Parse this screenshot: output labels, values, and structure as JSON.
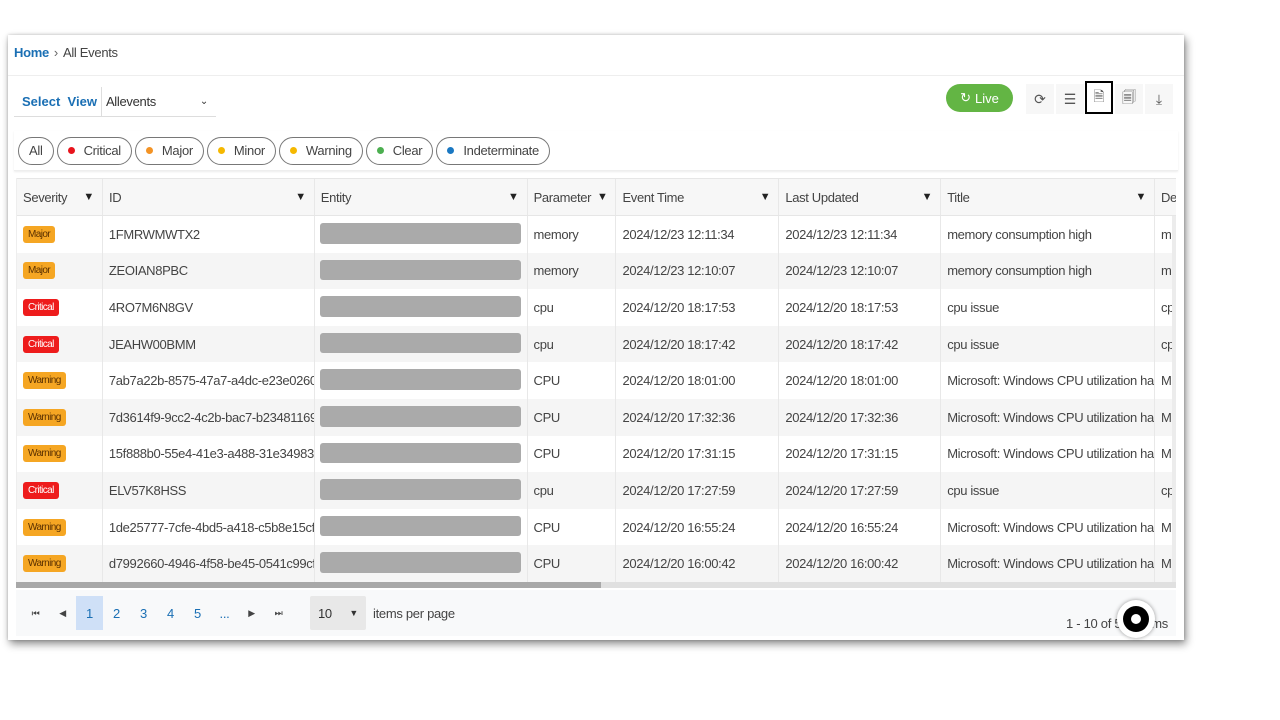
{
  "breadcrumb": {
    "home": "Home",
    "current": "All Events"
  },
  "view": {
    "label1": "Select",
    "label2": "View",
    "selected": "Allevents"
  },
  "toolbar": {
    "live_label": "Live",
    "icons": [
      "refresh-icon",
      "list-icon",
      "export-file-icon",
      "report-icon",
      "download-icon"
    ]
  },
  "filters": [
    {
      "label": "All",
      "color": null
    },
    {
      "label": "Critical",
      "color": "#e8141c"
    },
    {
      "label": "Major",
      "color": "#f39325"
    },
    {
      "label": "Minor",
      "color": "#f5b800"
    },
    {
      "label": "Warning",
      "color": "#f5b800"
    },
    {
      "label": "Clear",
      "color": "#4caf50"
    },
    {
      "label": "Indeterminate",
      "color": "#1a78c2"
    }
  ],
  "severity_colors": {
    "Major": "#f5a623",
    "Critical": "#ee1c1c",
    "Warning": "#f5a623"
  },
  "columns": [
    "Severity",
    "ID",
    "Entity",
    "Parameter",
    "Event Time",
    "Last Updated",
    "Title",
    "De"
  ],
  "rows": [
    {
      "severity": "Major",
      "id": "1FMRWMWTX2",
      "parameter": "memory",
      "event_time": "2024/12/23 12:11:34",
      "last_updated": "2024/12/23 12:11:34",
      "title": "memory consumption high",
      "desc": "m"
    },
    {
      "severity": "Major",
      "id": "ZEOIAN8PBC",
      "parameter": "memory",
      "event_time": "2024/12/23 12:10:07",
      "last_updated": "2024/12/23 12:10:07",
      "title": "memory consumption high",
      "desc": "m"
    },
    {
      "severity": "Critical",
      "id": "4RO7M6N8GV",
      "parameter": "cpu",
      "event_time": "2024/12/20 18:17:53",
      "last_updated": "2024/12/20 18:17:53",
      "title": "cpu issue",
      "desc": "cp"
    },
    {
      "severity": "Critical",
      "id": "JEAHW00BMM",
      "parameter": "cpu",
      "event_time": "2024/12/20 18:17:42",
      "last_updated": "2024/12/20 18:17:42",
      "title": "cpu issue",
      "desc": "cp"
    },
    {
      "severity": "Warning",
      "id": "7ab7a22b-8575-47a7-a4dc-e23e0260...",
      "parameter": "CPU",
      "event_time": "2024/12/20 18:01:00",
      "last_updated": "2024/12/20 18:01:00",
      "title": "Microsoft: Windows CPU utilization ha...",
      "desc": "M"
    },
    {
      "severity": "Warning",
      "id": "7d3614f9-9cc2-4c2b-bac7-b23481169...",
      "parameter": "CPU",
      "event_time": "2024/12/20 17:32:36",
      "last_updated": "2024/12/20 17:32:36",
      "title": "Microsoft: Windows CPU utilization ha...",
      "desc": "M"
    },
    {
      "severity": "Warning",
      "id": "15f888b0-55e4-41e3-a488-31e34983...",
      "parameter": "CPU",
      "event_time": "2024/12/20 17:31:15",
      "last_updated": "2024/12/20 17:31:15",
      "title": "Microsoft: Windows CPU utilization ha...",
      "desc": "M"
    },
    {
      "severity": "Critical",
      "id": "ELV57K8HSS",
      "parameter": "cpu",
      "event_time": "2024/12/20 17:27:59",
      "last_updated": "2024/12/20 17:27:59",
      "title": "cpu issue",
      "desc": "cp"
    },
    {
      "severity": "Warning",
      "id": "1de25777-7cfe-4bd5-a418-c5b8e15cf...",
      "parameter": "CPU",
      "event_time": "2024/12/20 16:55:24",
      "last_updated": "2024/12/20 16:55:24",
      "title": "Microsoft: Windows CPU utilization ha...",
      "desc": "M"
    },
    {
      "severity": "Warning",
      "id": "d7992660-4946-4f58-be45-0541c99cf...",
      "parameter": "CPU",
      "event_time": "2024/12/20 16:00:42",
      "last_updated": "2024/12/20 16:00:42",
      "title": "Microsoft: Windows CPU utilization ha...",
      "desc": "M"
    }
  ],
  "pagination": {
    "pages": [
      "1",
      "2",
      "3",
      "4",
      "5",
      "..."
    ],
    "current": "1",
    "page_size": "10",
    "items_per_page_label": "items per page",
    "summary_left": "1 - 10 of 5",
    "summary_right": "ms"
  }
}
